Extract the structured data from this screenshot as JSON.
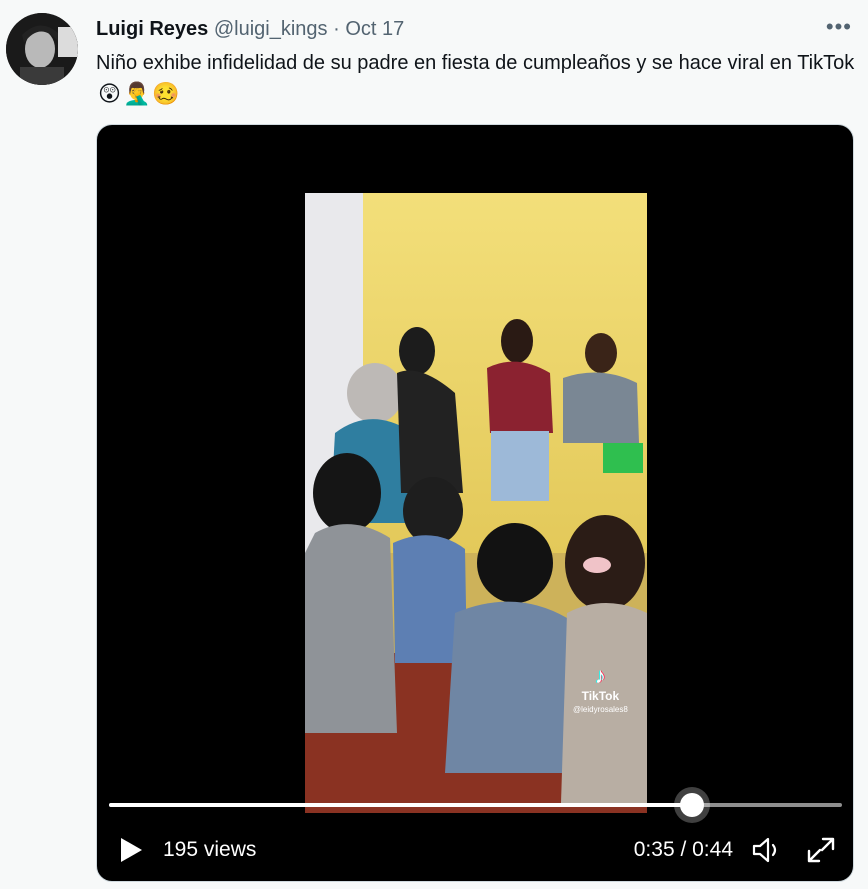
{
  "tweet": {
    "author_name": "Luigi Reyes",
    "author_handle": "@luigi_kings",
    "separator": "·",
    "date": "Oct 17",
    "more_label": "•••",
    "text": "Niño exhibe infidelidad de su padre en fiesta de cumpleaños y se hace viral en TikTok",
    "emojis": [
      "😲",
      "🤦‍♂️",
      "🥴"
    ]
  },
  "video": {
    "watermark_brand": "TikTok",
    "watermark_user": "@leidyrosales8",
    "views_label": "195 views",
    "time_label": "0:35 / 0:44",
    "progress": 0.795,
    "icons": {
      "play": "play-icon",
      "volume": "volume-icon",
      "fullscreen": "fullscreen-icon"
    },
    "colors": {
      "background": "#000000",
      "track": "#8e8e8e",
      "fill": "#ffffff"
    }
  }
}
